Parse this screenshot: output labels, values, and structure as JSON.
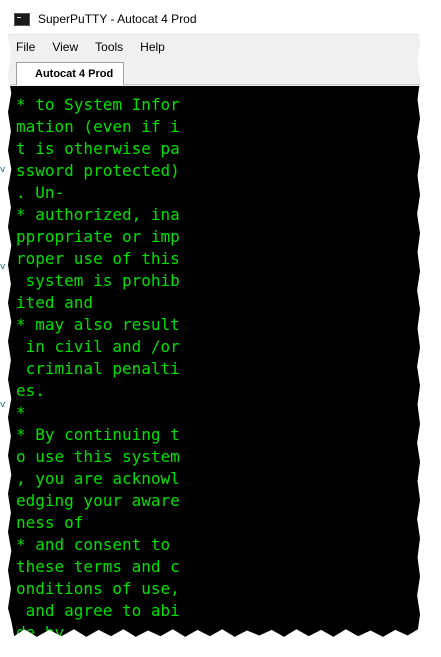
{
  "window": {
    "title": "SuperPuTTY - Autocat 4 Prod"
  },
  "menu": [
    "File",
    "View",
    "Tools",
    "Help"
  ],
  "tab": {
    "label": "Autocat 4 Prod"
  },
  "terminal": {
    "text_color": "#00e000",
    "background": "#000000",
    "lines": [
      "* to System Infor",
      "mation (even if i",
      "t is otherwise pa",
      "ssword protected)",
      ". Un-",
      "* authorized, ina",
      "ppropriate or imp",
      "roper use of this",
      " system is prohib",
      "ited and",
      "* may also result",
      " in civil and /or",
      " criminal penalti",
      "es.",
      "*",
      "* By continuing t",
      "o use this system",
      ", you are acknowl",
      "edging your aware",
      "ness of",
      "* and consent to",
      "these terms and c",
      "onditions of use,",
      " and agree to abi",
      "de by"
    ]
  }
}
